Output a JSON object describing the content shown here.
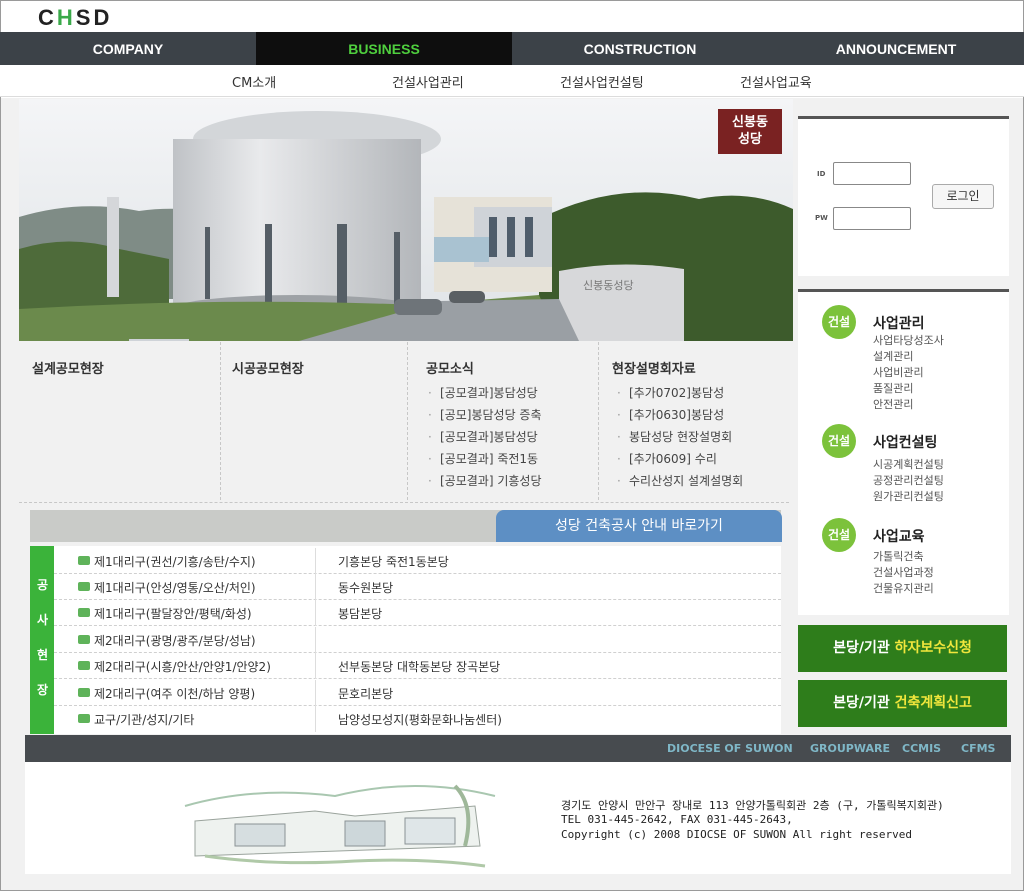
{
  "logo": {
    "c1": "C",
    "h": "H",
    "c2": "SD"
  },
  "topnav": {
    "items": [
      "COMPANY",
      "BUSINESS",
      "CONSTRUCTION",
      "ANNOUNCEMENT"
    ],
    "active_index": 1
  },
  "subnav": {
    "items": [
      "CM소개",
      "건설사업관리",
      "건설사업컨설팅",
      "건설사업교육"
    ]
  },
  "hero": {
    "tag_line1": "신봉동",
    "tag_line2": "성당",
    "building_sign": "신봉동성당"
  },
  "login": {
    "id_label": "ID",
    "pw_label": "PW",
    "button": "로그인"
  },
  "right_menu": {
    "sections": [
      {
        "badge": "건설",
        "title": "사업관리",
        "links": [
          "사업타당성조사",
          "설계관리",
          "사업비관리",
          "품질관리",
          "안전관리"
        ]
      },
      {
        "badge": "건설",
        "title": "사업컨설팅",
        "links": [
          "시공계획컨설팅",
          "공정관리컨설팅",
          "원가관리컨설팅"
        ]
      },
      {
        "badge": "건설",
        "title": "사업교육",
        "links": [
          "가톨릭건축",
          "건설사업과정",
          "건물유지관리"
        ]
      }
    ]
  },
  "green_buttons": [
    {
      "prefix": "본당/기관",
      "highlight": "하자보수신청"
    },
    {
      "prefix": "본당/기관",
      "highlight": "건축계획신고"
    }
  ],
  "columns": [
    {
      "title": "설계공모현장",
      "items": []
    },
    {
      "title": "시공공모현장",
      "items": []
    },
    {
      "title": "공모소식",
      "items": [
        "[공모결과]봉담성당",
        "[공모]봉담성당 증축",
        "[공모결과]봉담성당",
        "[공모결과] 죽전1동",
        "[공모결과] 기흥성당"
      ]
    },
    {
      "title": "현장설명회자료",
      "items": [
        "[추가0702]봉담성",
        "[추가0630]봉담성",
        "봉담성당 현장설명회",
        "[추가0609] 수리",
        "수리산성지 설계설명회"
      ]
    }
  ],
  "church_button": "성당 건축공사 안내 바로가기",
  "construction_site_label": [
    "공",
    "사",
    "현",
    "장"
  ],
  "parish_rows": [
    {
      "district": "제1대리구(권선/기흥/송탄/수지)",
      "parishes": "기흥본당  죽전1동본당"
    },
    {
      "district": "제1대리구(안성/영통/오산/처인)",
      "parishes": "동수원본당"
    },
    {
      "district": "제1대리구(팔달장안/평택/화성)",
      "parishes": "봉담본당"
    },
    {
      "district": "제2대리구(광명/광주/분당/성남)",
      "parishes": ""
    },
    {
      "district": "제2대리구(시흥/안산/안양1/안양2)",
      "parishes": "선부동본당  대학동본당  장곡본당"
    },
    {
      "district": "제2대리구(여주 이천/하남 양평)",
      "parishes": "문호리본당"
    },
    {
      "district": "교구/기관/성지/기타",
      "parishes": "남양성모성지(평화문화나눔센터)"
    }
  ],
  "footer": {
    "links": [
      "DIOCESE OF SUWON",
      "GROUPWARE",
      "CCMIS",
      "CFMS"
    ],
    "address": "경기도 안양시 만안구 장내로 113 안양가톨릭회관 2층 (구, 가톨릭복지회관)",
    "contact": "TEL 031-445-2642,  FAX 031-445-2643,",
    "copyright": "Copyright (c) 2008 DIOCSE OF SUWON All right reserved"
  },
  "colors": {
    "nav_bg": "#3c4248",
    "active_green": "#4fcf3e",
    "badge_green": "#7cc23b",
    "button_green": "#2e7d1b",
    "church_blue": "#5d8fc4",
    "tag_red": "#7a2222"
  }
}
